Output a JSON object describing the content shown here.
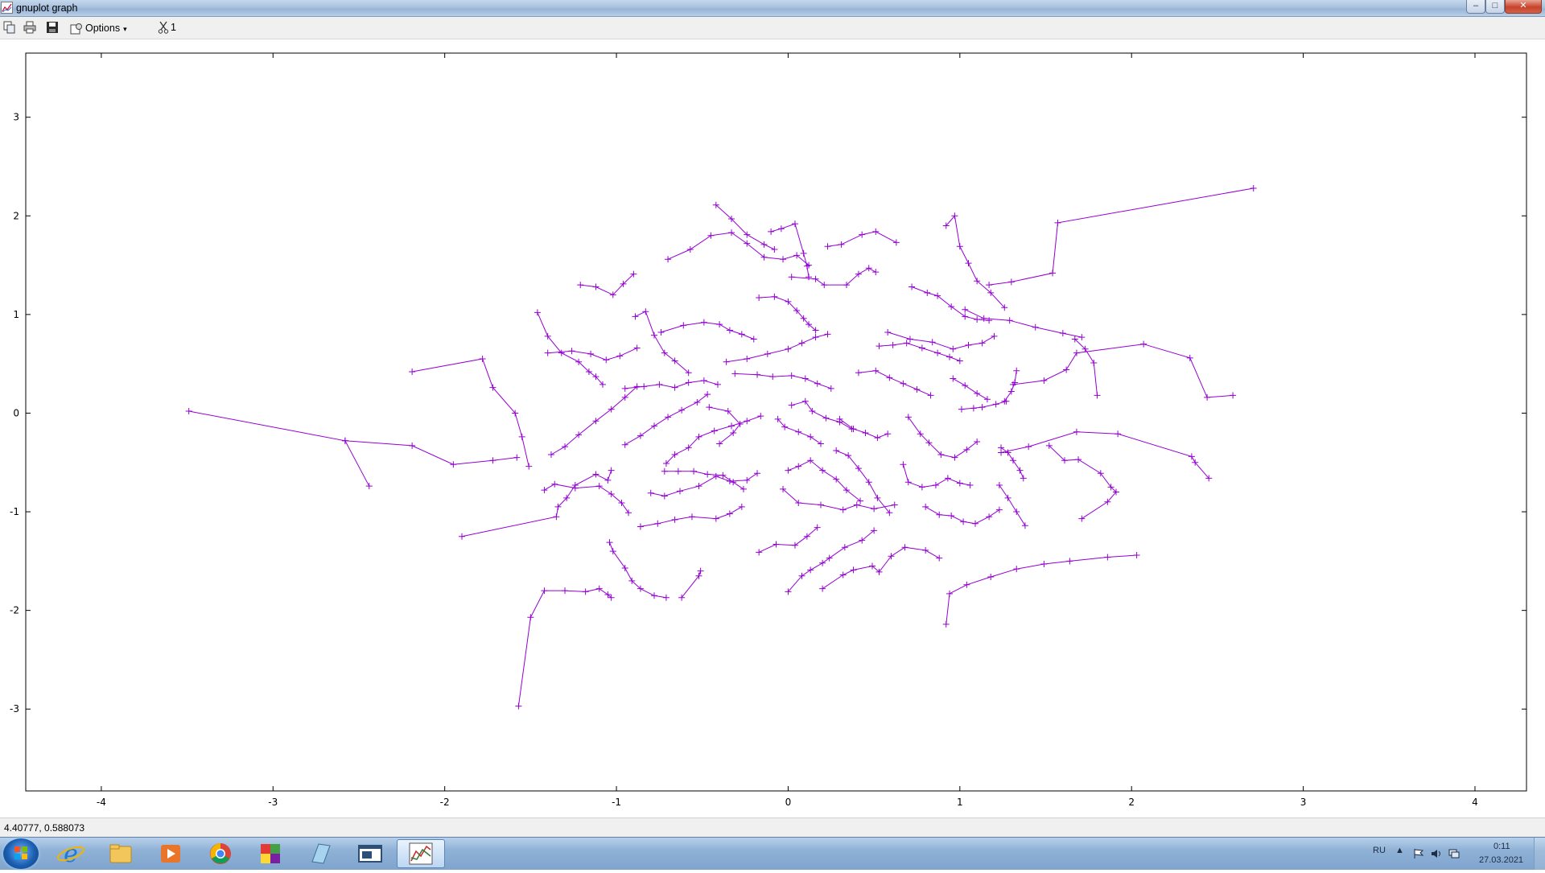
{
  "window": {
    "title": "gnuplot graph"
  },
  "titlebar_buttons": {
    "minimize": "–",
    "maximize": "□",
    "close": "✕"
  },
  "toolbar": {
    "icons": [
      "copy-icon",
      "print-icon",
      "save-icon",
      "options-icon",
      "scissors-icon"
    ],
    "options_label": "Options",
    "options_arrow": "▾",
    "scissor_label": "1"
  },
  "chart_data": {
    "type": "line",
    "title": "",
    "xlabel": "",
    "ylabel": "",
    "xlim": [
      -4.44,
      4.3
    ],
    "ylim": [
      -3.83,
      3.65
    ],
    "x_ticks": [
      -4,
      -3,
      -2,
      -1,
      0,
      1,
      2,
      3,
      4
    ],
    "y_ticks": [
      -3,
      -2,
      -1,
      0,
      1,
      2,
      3
    ],
    "grid": false,
    "legend": "none",
    "line_color": "#9400d3",
    "marker": "plus",
    "series": [
      {
        "x": [
          -3.49,
          -2.58,
          -2.44
        ],
        "y": [
          0.02,
          -0.28,
          -0.74
        ]
      },
      {
        "x": [
          -2.19,
          -1.78,
          -1.72,
          -1.59,
          -1.55,
          -1.51
        ],
        "y": [
          0.42,
          0.55,
          0.26,
          0.0,
          -0.24,
          -0.54
        ]
      },
      {
        "x": [
          -2.58,
          -2.19,
          -1.95,
          -1.72,
          -1.58
        ],
        "y": [
          -0.28,
          -0.33,
          -0.52,
          -0.48,
          -0.45
        ]
      },
      {
        "x": [
          -1.9,
          -1.35,
          -1.34,
          -1.29,
          -1.24,
          -1.12,
          -1.05,
          -1.03
        ],
        "y": [
          -1.25,
          -1.05,
          -0.95,
          -0.86,
          -0.73,
          -0.62,
          -0.68,
          -0.58
        ]
      },
      {
        "x": [
          -1.57,
          -1.5,
          -1.42,
          -1.3,
          -1.18,
          -1.1,
          -1.05,
          -1.03
        ],
        "y": [
          -2.97,
          -2.07,
          -1.8,
          -1.8,
          -1.81,
          -1.78,
          -1.84,
          -1.87
        ]
      },
      {
        "x": [
          -0.62,
          -0.52,
          -0.51
        ],
        "y": [
          -1.87,
          -1.65,
          -1.6
        ]
      },
      {
        "x": [
          -1.04,
          -1.02,
          -0.95,
          -0.91,
          -0.86,
          -0.78,
          -0.71
        ],
        "y": [
          -1.31,
          -1.4,
          -1.57,
          -1.7,
          -1.78,
          -1.85,
          -1.87
        ]
      },
      {
        "x": [
          -1.42,
          -1.36,
          -1.24,
          -1.1,
          -1.03,
          -0.97,
          -0.93
        ],
        "y": [
          -0.78,
          -0.72,
          -0.76,
          -0.74,
          -0.82,
          -0.91,
          -1.01
        ]
      },
      {
        "x": [
          -1.38,
          -1.3,
          -1.22,
          -1.12,
          -1.03,
          -0.95,
          -0.88
        ],
        "y": [
          -0.42,
          -0.34,
          -0.22,
          -0.08,
          0.04,
          0.16,
          0.27
        ]
      },
      {
        "x": [
          -1.46,
          -1.4,
          -1.32,
          -1.22,
          -1.16,
          -1.12,
          -1.08
        ],
        "y": [
          1.02,
          0.78,
          0.61,
          0.52,
          0.42,
          0.37,
          0.29
        ]
      },
      {
        "x": [
          -1.21,
          -1.12,
          -1.02,
          -0.96,
          -0.9
        ],
        "y": [
          1.3,
          1.28,
          1.2,
          1.31,
          1.41
        ]
      },
      {
        "x": [
          -1.4,
          -1.26,
          -1.15,
          -1.06,
          -0.98,
          -0.88
        ],
        "y": [
          0.61,
          0.63,
          0.6,
          0.54,
          0.58,
          0.66
        ]
      },
      {
        "x": [
          -0.89,
          -0.83,
          -0.78,
          -0.72,
          -0.66,
          -0.58
        ],
        "y": [
          0.98,
          1.03,
          0.79,
          0.61,
          0.53,
          0.41
        ]
      },
      {
        "x": [
          -0.74,
          -0.61,
          -0.49,
          -0.4,
          -0.34,
          -0.27,
          -0.2
        ],
        "y": [
          0.82,
          0.89,
          0.92,
          0.9,
          0.84,
          0.8,
          0.75
        ]
      },
      {
        "x": [
          -0.7,
          -0.57,
          -0.45,
          -0.33,
          -0.24,
          -0.14,
          -0.03,
          0.05,
          0.12
        ],
        "y": [
          1.56,
          1.66,
          1.8,
          1.83,
          1.72,
          1.58,
          1.56,
          1.6,
          1.5
        ]
      },
      {
        "x": [
          -0.42,
          -0.33,
          -0.24,
          -0.14,
          -0.08
        ],
        "y": [
          2.11,
          1.97,
          1.81,
          1.71,
          1.66
        ]
      },
      {
        "x": [
          -0.1,
          -0.04,
          0.04,
          0.09,
          0.11,
          0.12
        ],
        "y": [
          1.84,
          1.87,
          1.92,
          1.62,
          1.49,
          1.38
        ]
      },
      {
        "x": [
          0.02,
          0.16,
          0.21,
          0.34,
          0.41,
          0.47,
          0.51
        ],
        "y": [
          1.38,
          1.36,
          1.3,
          1.3,
          1.41,
          1.47,
          1.43
        ]
      },
      {
        "x": [
          0.23,
          0.31,
          0.43,
          0.51,
          0.63
        ],
        "y": [
          1.69,
          1.71,
          1.81,
          1.84,
          1.73
        ]
      },
      {
        "x": [
          0.72,
          0.81,
          0.87,
          0.95,
          1.03,
          1.1,
          1.17
        ],
        "y": [
          1.28,
          1.22,
          1.19,
          1.08,
          0.98,
          0.95,
          0.94
        ]
      },
      {
        "x": [
          0.92,
          0.97,
          1.0,
          1.05,
          1.1,
          1.18,
          1.26
        ],
        "y": [
          1.9,
          2.0,
          1.69,
          1.52,
          1.34,
          1.22,
          1.07
        ]
      },
      {
        "x": [
          1.17,
          1.3,
          1.54,
          1.57,
          2.71
        ],
        "y": [
          1.3,
          1.33,
          1.42,
          1.93,
          2.28
        ]
      },
      {
        "x": [
          1.03,
          1.14,
          1.29,
          1.44,
          1.6,
          1.71
        ],
        "y": [
          1.05,
          0.96,
          0.94,
          0.87,
          0.81,
          0.77
        ]
      },
      {
        "x": [
          1.31,
          1.49,
          1.62,
          1.68,
          2.07,
          2.34,
          2.44,
          2.59
        ],
        "y": [
          0.29,
          0.33,
          0.44,
          0.61,
          0.7,
          0.56,
          0.16,
          0.18
        ]
      },
      {
        "x": [
          1.67,
          1.73,
          1.78,
          1.8
        ],
        "y": [
          0.75,
          0.65,
          0.51,
          0.18
        ]
      },
      {
        "x": [
          1.24,
          1.4,
          1.68,
          1.92,
          2.35,
          2.37,
          2.45
        ],
        "y": [
          -0.4,
          -0.34,
          -0.19,
          -0.21,
          -0.44,
          -0.5,
          -0.66
        ]
      },
      {
        "x": [
          1.52,
          1.61,
          1.69,
          1.82,
          1.88,
          1.91,
          1.86,
          1.71
        ],
        "y": [
          -0.33,
          -0.48,
          -0.47,
          -0.61,
          -0.75,
          -0.8,
          -0.9,
          -1.07
        ]
      },
      {
        "x": [
          0.92,
          0.94,
          1.04,
          1.18,
          1.33,
          1.49,
          1.64,
          1.86,
          2.03
        ],
        "y": [
          -2.14,
          -1.83,
          -1.74,
          -1.66,
          -1.58,
          -1.53,
          -1.5,
          -1.46,
          -1.44
        ]
      },
      {
        "x": [
          0.2,
          0.32,
          0.38,
          0.49,
          0.53,
          0.6,
          0.68,
          0.8,
          0.88
        ],
        "y": [
          -1.78,
          -1.64,
          -1.59,
          -1.55,
          -1.61,
          -1.45,
          -1.36,
          -1.39,
          -1.47
        ]
      },
      {
        "x": [
          0.0,
          0.08,
          0.13,
          0.2,
          0.24,
          0.33,
          0.43,
          0.5
        ],
        "y": [
          -1.81,
          -1.65,
          -1.59,
          -1.52,
          -1.47,
          -1.36,
          -1.29,
          -1.19
        ]
      },
      {
        "x": [
          -0.17,
          -0.07,
          0.04,
          0.11,
          0.17
        ],
        "y": [
          -1.41,
          -1.33,
          -1.34,
          -1.25,
          -1.16
        ]
      },
      {
        "x": [
          -0.86,
          -0.76,
          -0.66,
          -0.56,
          -0.42,
          -0.34,
          -0.27
        ],
        "y": [
          -1.15,
          -1.12,
          -1.08,
          -1.05,
          -1.07,
          -1.02,
          -0.95
        ]
      },
      {
        "x": [
          -0.8,
          -0.72,
          -0.63,
          -0.52,
          -0.42,
          -0.34,
          -0.24,
          -0.18
        ],
        "y": [
          -0.81,
          -0.84,
          -0.79,
          -0.74,
          -0.64,
          -0.69,
          -0.68,
          -0.61
        ]
      },
      {
        "x": [
          -0.72,
          -0.64,
          -0.55,
          -0.47,
          -0.38,
          -0.32,
          -0.26
        ],
        "y": [
          -0.59,
          -0.59,
          -0.59,
          -0.62,
          -0.63,
          -0.7,
          -0.77
        ]
      },
      {
        "x": [
          -0.71,
          -0.66,
          -0.58,
          -0.52,
          -0.43,
          -0.33,
          -0.24,
          -0.16
        ],
        "y": [
          -0.51,
          -0.42,
          -0.35,
          -0.24,
          -0.18,
          -0.13,
          -0.08,
          -0.03
        ]
      },
      {
        "x": [
          -0.95,
          -0.86,
          -0.78,
          -0.7,
          -0.62,
          -0.53,
          -0.47
        ],
        "y": [
          -0.32,
          -0.23,
          -0.13,
          -0.04,
          0.03,
          0.11,
          0.19
        ]
      },
      {
        "x": [
          -0.95,
          -0.84,
          -0.75,
          -0.66,
          -0.58,
          -0.49,
          -0.41
        ],
        "y": [
          0.25,
          0.27,
          0.29,
          0.26,
          0.31,
          0.33,
          0.29
        ]
      },
      {
        "x": [
          -0.31,
          -0.18,
          -0.09,
          0.02,
          0.1,
          0.17,
          0.25
        ],
        "y": [
          0.4,
          0.39,
          0.37,
          0.38,
          0.35,
          0.3,
          0.25
        ]
      },
      {
        "x": [
          -0.36,
          -0.24,
          -0.12,
          0.0,
          0.08,
          0.16,
          0.23
        ],
        "y": [
          0.52,
          0.55,
          0.6,
          0.65,
          0.71,
          0.77,
          0.8
        ]
      },
      {
        "x": [
          -0.17,
          -0.08,
          0.0,
          0.05,
          0.09,
          0.12,
          0.16
        ],
        "y": [
          1.17,
          1.18,
          1.13,
          1.04,
          0.96,
          0.9,
          0.84
        ]
      },
      {
        "x": [
          -0.46,
          -0.35,
          -0.28,
          -0.32,
          -0.4
        ],
        "y": [
          0.06,
          0.02,
          -0.11,
          -0.2,
          -0.31
        ]
      },
      {
        "x": [
          -0.06,
          -0.02,
          0.06,
          0.13,
          0.19
        ],
        "y": [
          -0.06,
          -0.14,
          -0.19,
          -0.24,
          -0.31
        ]
      },
      {
        "x": [
          0.02,
          0.1,
          0.14,
          0.22,
          0.3,
          0.37
        ],
        "y": [
          0.08,
          0.12,
          0.02,
          -0.05,
          -0.09,
          -0.16
        ]
      },
      {
        "x": [
          0.0,
          0.06,
          0.13,
          0.2,
          0.28,
          0.34,
          0.42
        ],
        "y": [
          -0.58,
          -0.54,
          -0.48,
          -0.58,
          -0.67,
          -0.78,
          -0.89
        ]
      },
      {
        "x": [
          -0.03,
          0.06,
          0.19,
          0.32,
          0.4,
          0.5,
          0.62
        ],
        "y": [
          -0.77,
          -0.91,
          -0.93,
          -0.98,
          -0.93,
          -0.97,
          -0.93
        ]
      },
      {
        "x": [
          0.28,
          0.35,
          0.41,
          0.47,
          0.52,
          0.59
        ],
        "y": [
          -0.38,
          -0.43,
          -0.56,
          -0.7,
          -0.86,
          -1.01
        ]
      },
      {
        "x": [
          0.3,
          0.38,
          0.45,
          0.52,
          0.58
        ],
        "y": [
          -0.06,
          -0.16,
          -0.2,
          -0.25,
          -0.21
        ]
      },
      {
        "x": [
          0.41,
          0.51,
          0.59,
          0.67,
          0.75,
          0.83
        ],
        "y": [
          0.41,
          0.43,
          0.36,
          0.3,
          0.24,
          0.18
        ]
      },
      {
        "x": [
          0.53,
          0.61,
          0.69,
          0.78,
          0.87,
          0.94,
          1.0
        ],
        "y": [
          0.68,
          0.69,
          0.71,
          0.66,
          0.61,
          0.57,
          0.53
        ]
      },
      {
        "x": [
          0.58,
          0.71,
          0.84,
          0.96,
          1.05,
          1.13,
          1.2
        ],
        "y": [
          0.82,
          0.75,
          0.72,
          0.65,
          0.69,
          0.71,
          0.78
        ]
      },
      {
        "x": [
          0.7,
          0.77,
          0.82,
          0.89,
          0.97,
          1.04,
          1.1
        ],
        "y": [
          -0.04,
          -0.21,
          -0.3,
          -0.42,
          -0.45,
          -0.37,
          -0.29
        ]
      },
      {
        "x": [
          0.67,
          0.7,
          0.78,
          0.86,
          0.93,
          1.0,
          1.06
        ],
        "y": [
          -0.52,
          -0.7,
          -0.75,
          -0.73,
          -0.66,
          -0.71,
          -0.73
        ]
      },
      {
        "x": [
          0.8,
          0.88,
          0.95,
          1.02,
          1.09,
          1.17,
          1.23
        ],
        "y": [
          -0.95,
          -1.03,
          -1.04,
          -1.1,
          -1.12,
          -1.05,
          -0.98
        ]
      },
      {
        "x": [
          1.23,
          1.28,
          1.33,
          1.38
        ],
        "y": [
          -0.73,
          -0.86,
          -1.0,
          -1.14
        ]
      },
      {
        "x": [
          1.24,
          1.28,
          1.31,
          1.35,
          1.37
        ],
        "y": [
          -0.35,
          -0.4,
          -0.48,
          -0.58,
          -0.66
        ]
      },
      {
        "x": [
          1.26,
          1.3,
          1.32,
          1.33
        ],
        "y": [
          0.12,
          0.22,
          0.31,
          0.43
        ]
      },
      {
        "x": [
          1.01,
          1.08,
          1.13,
          1.21,
          1.27
        ],
        "y": [
          0.04,
          0.05,
          0.06,
          0.09,
          0.12
        ]
      },
      {
        "x": [
          0.96,
          1.03,
          1.1,
          1.16
        ],
        "y": [
          0.35,
          0.28,
          0.2,
          0.14
        ]
      }
    ]
  },
  "status": {
    "coords": "4.40777,  0.588073"
  },
  "taskbar": {
    "apps": [
      "windows-start-icon",
      "internet-explorer-icon",
      "file-explorer-icon",
      "media-player-icon",
      "chrome-icon",
      "colorful-app-icon",
      "notepad-icon",
      "console-app-icon",
      "gnuplot-icon"
    ],
    "tray_lang": "RU",
    "tray_arrow": "▲",
    "time": "0:11",
    "date": "27.03.2021"
  }
}
